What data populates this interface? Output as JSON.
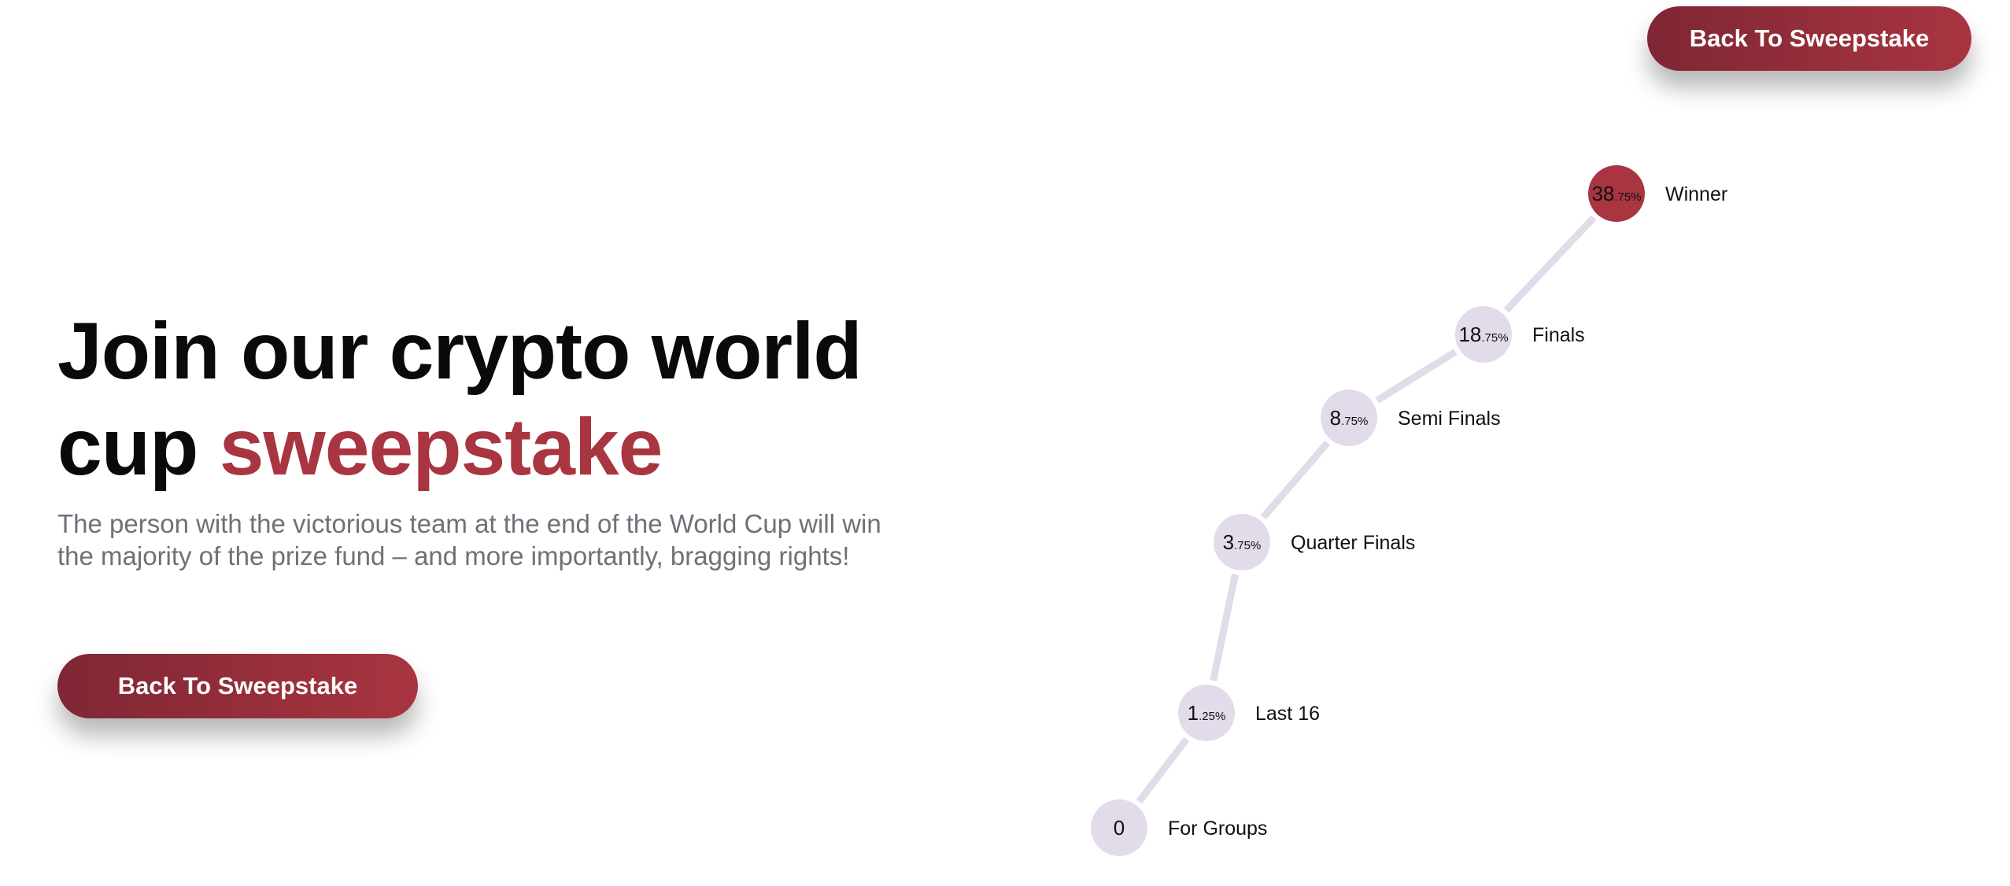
{
  "header": {
    "back_button_label": "Back To Sweepstake"
  },
  "hero": {
    "title_line1": "Join our crypto world",
    "title_line2_prefix": "cup ",
    "title_accent": "sweepstake",
    "description": "The person with the victorious team at the end of the World Cup will win the majority of the prize fund – and more importantly, bragging rights!",
    "back_button_label": "Back To Sweepstake"
  },
  "colors": {
    "accent": "#a83540",
    "node": "#e2dbe9",
    "line": "#e2dbe9"
  },
  "prize_ladder": [
    {
      "stage": "For Groups",
      "whole": "0",
      "fraction": "",
      "highlight": false
    },
    {
      "stage": "Last 16",
      "whole": "1",
      "fraction": ".25%",
      "highlight": false
    },
    {
      "stage": "Quarter Finals",
      "whole": "3",
      "fraction": ".75%",
      "highlight": false
    },
    {
      "stage": "Semi Finals",
      "whole": "8",
      "fraction": ".75%",
      "highlight": false
    },
    {
      "stage": "Finals",
      "whole": "18",
      "fraction": ".75%",
      "highlight": false
    },
    {
      "stage": "Winner",
      "whole": "38",
      "fraction": ".75%",
      "highlight": true
    }
  ]
}
